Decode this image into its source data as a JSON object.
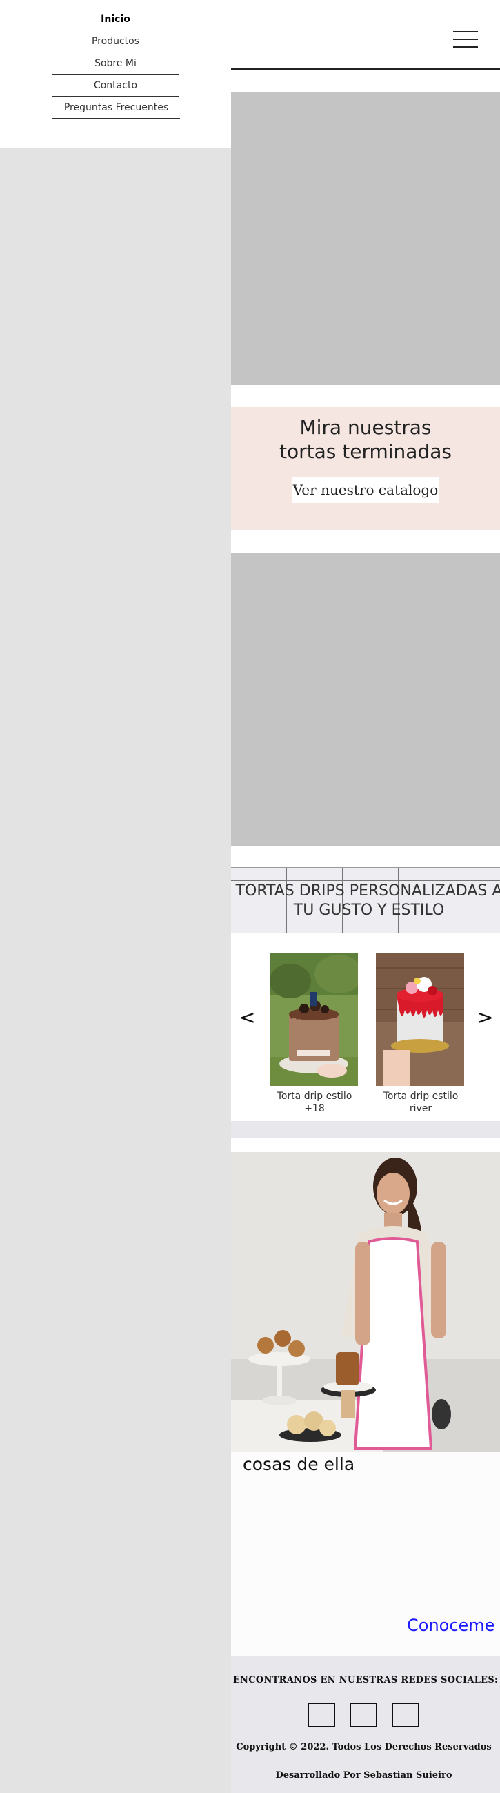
{
  "nav": {
    "items": [
      {
        "label": "Inicio",
        "active": true
      },
      {
        "label": "Productos",
        "active": false
      },
      {
        "label": "Sobre Mi",
        "active": false
      },
      {
        "label": "Contacto",
        "active": false
      },
      {
        "label": "Preguntas Frecuentes",
        "active": false
      }
    ]
  },
  "header": {
    "menu_icon": "hamburger-menu-icon"
  },
  "promo": {
    "title": "Mira nuestras\ntortas terminadas",
    "button_label": "Ver nuestro catalogo"
  },
  "section": {
    "title": "TORTAS DRIPS PERSONALIZADAS A\nTU GUSTO Y ESTILO"
  },
  "carousel": {
    "prev_label": "<",
    "next_label": ">",
    "cards": [
      {
        "label": "Torta drip estilo +18"
      },
      {
        "label": "Torta drip estilo river"
      }
    ]
  },
  "about": {
    "text": "cosas de ella",
    "link_label": "Conoceme"
  },
  "footer": {
    "heading": "ENCONTRANOS EN NUESTRAS REDES SOCIALES:",
    "copyright": "Copyright © 2022. Todos Los Derechos Reservados",
    "developer": "Desarrollado Por Sebastian Suieiro"
  },
  "colors": {
    "page_bg": "#e3e3e3",
    "placeholder_gray": "#c4c4c4",
    "promo_bg": "#f5e6e1",
    "link_blue": "#1a1aff",
    "footer_bg": "#e8e8ec"
  }
}
